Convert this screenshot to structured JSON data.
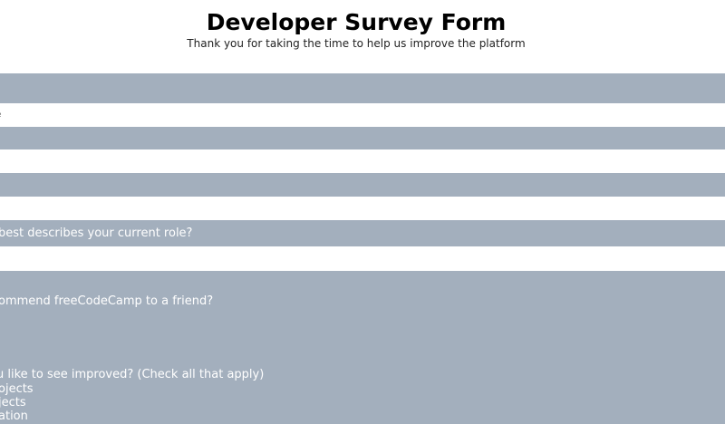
{
  "header": {
    "title": "Developer Survey Form",
    "subtitle": "Thank you for taking the time to help us improve the platform"
  },
  "fields": {
    "name_placeholder": "e"
  },
  "questions": {
    "role": "best describes your current role?",
    "recommend": "ommend freeCodeCamp to a friend?",
    "improve": "u like to see improved? (Check all that apply)"
  },
  "improve_options": [
    "ojects",
    "jects",
    "ation"
  ],
  "colors": {
    "band": "#a3afbd",
    "background": "#ffffff"
  }
}
